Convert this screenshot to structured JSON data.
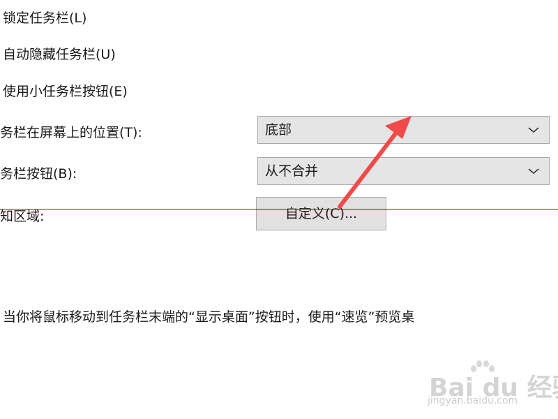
{
  "options": {
    "lock_taskbar": "锁定任务栏(L)",
    "auto_hide": "自动隐藏任务栏(U)",
    "small_buttons": "使用小任务栏按钮(E)"
  },
  "position": {
    "label": "务栏在屏幕上的位置(T):",
    "value": "底部"
  },
  "buttons_combine": {
    "label": "务栏按钮(B):",
    "value": "从不合并"
  },
  "notification": {
    "label": "知区域:",
    "customize_label": "自定义(C)..."
  },
  "peek_text": "当你将鼠标移动到任务栏末端的“显示桌面”按钮时，使用“速览”预览桌",
  "watermark": {
    "logo": "Bai du 经验",
    "url": "jingyan.baidu.com"
  },
  "colors": {
    "annotation_arrow": "#f04a4a",
    "annotation_line": "#b30000"
  },
  "icons": {
    "dropdown": "chevron-down-icon",
    "pointer": "arrow-icon"
  }
}
